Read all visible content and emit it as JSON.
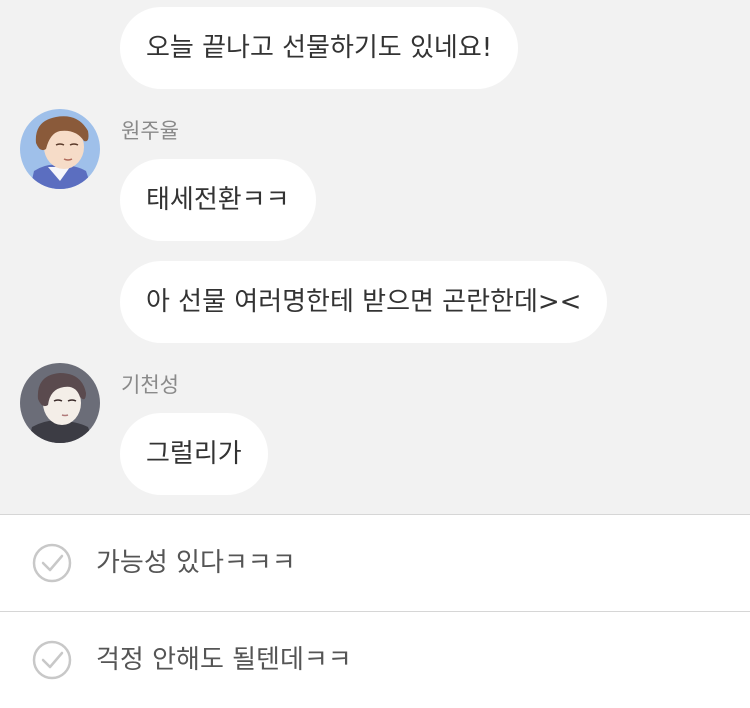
{
  "messages": [
    {
      "text": "오늘 끝나고 선물하기도 있네요!"
    },
    {
      "sender": "원주율",
      "avatar_icon": "boy-with-brown-hair-avatar",
      "text": "태세전환ㅋㅋ"
    },
    {
      "text": "아 선물 여러명한테 받으면 곤란한데><"
    },
    {
      "sender": "기천성",
      "avatar_icon": "boy-with-dark-hair-avatar",
      "text": "그럴리가"
    }
  ],
  "options": [
    {
      "label": "가능성 있다ㅋㅋㅋ",
      "icon": "check-circle-icon"
    },
    {
      "label": "걱정 안해도 될텐데ㅋㅋ",
      "icon": "check-circle-icon"
    }
  ],
  "colors": {
    "chat_background": "#f2f2f2",
    "bubble": "#ffffff",
    "sender_name": "#8a8a8a",
    "divider": "#d6d6d6",
    "check_icon": "#c8c8c8"
  }
}
